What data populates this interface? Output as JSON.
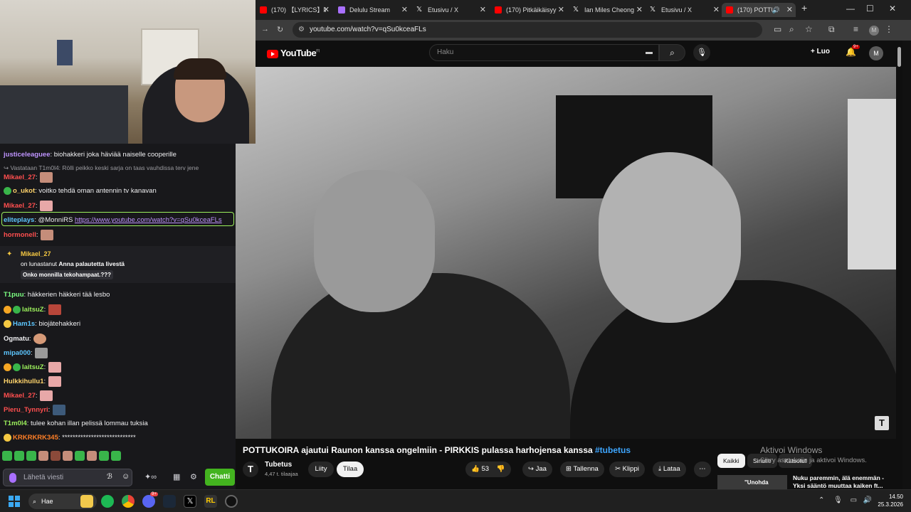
{
  "chat": {
    "messages": [
      {
        "user": "justiceleaguee",
        "color": "#bf94ff",
        "text": "biohakkeri joka häviää naiselle cooperille"
      },
      {
        "reply": "Vastataan T1m0l4: Rölli peikko keski sarja on taas vauhdissa terv jene"
      },
      {
        "user": "Mikael_27",
        "color": "#ff4f4f",
        "text": ""
      },
      {
        "user": "o_ukot",
        "color": "#ffd36b",
        "text": "voitko tehdä oman antennin tv kanavan"
      },
      {
        "user": "Mikael_27",
        "color": "#ff4f4f",
        "text": ""
      },
      {
        "user": "eliteplays",
        "color": "#5dc6ff",
        "text": "@MonniRS ",
        "link": "https://www.youtube.com/watch?v=qSu0kceaFLs"
      },
      {
        "user": "hormonell",
        "color": "#ff4f4f",
        "text": ""
      },
      {
        "user": "T1puu",
        "color": "#7dff83",
        "text": "häkkerien häkkeri tää lesbo"
      },
      {
        "user": "laitsuZ",
        "color": "#9cf05c",
        "text": ""
      },
      {
        "user": "Ham1s",
        "color": "#5dc6ff",
        "text": "biojätehakkeri"
      },
      {
        "user": "Ogmatu",
        "color": "#efeff1",
        "text": ""
      },
      {
        "user": "mipa000",
        "color": "#5dc6ff",
        "text": ""
      },
      {
        "user": "laitsuZ",
        "color": "#9cf05c",
        "text": ""
      },
      {
        "user": "Hulkkihullu1",
        "color": "#ffd36b",
        "text": ""
      },
      {
        "user": "Mikael_27",
        "color": "#ff4f4f",
        "text": ""
      },
      {
        "user": "Pieru_Tynnyri",
        "color": "#ff4f4f",
        "text": ""
      },
      {
        "user": "T1m0l4",
        "color": "#9cf05c",
        "text": "tulee kohan illan pelissä lommau tuksia"
      },
      {
        "user": "KRKRKRK345",
        "color": "#ff7f27",
        "text": "****************************"
      }
    ],
    "redeem": {
      "user": "Mikael_27",
      "line": "on lunastanut",
      "reward": "Anna palautetta livestä",
      "message": "Onko monnilla tekohampaat.???"
    },
    "input_placeholder": "Lähetä viesti",
    "chat_button": "Chatti"
  },
  "browser": {
    "tabs": [
      {
        "title": "(170) 【LYRICS】li",
        "color": "#ff0000"
      },
      {
        "title": "Delulu Stream",
        "color": "#a970ff"
      },
      {
        "title": "Etusivu / X",
        "color": "#ffffff"
      },
      {
        "title": "(170) Pitkäikäisyy",
        "color": "#ff0000"
      },
      {
        "title": "Ian Miles Cheong",
        "color": "#ffffff"
      },
      {
        "title": "Etusivu / X",
        "color": "#ffffff"
      },
      {
        "title": "(170) POTTU",
        "color": "#ff0000"
      }
    ],
    "url": "youtube.com/watch?v=qSu0kceaFLs",
    "profile_initial": "M"
  },
  "youtube": {
    "logo": "YouTube",
    "region": "FI",
    "search_placeholder": "Haku",
    "create_label": "Luo",
    "notif_count": "9+",
    "avatar_initial": "M",
    "video_title": "POTTUKOIRA ajautui Raunon kanssa ongelmiin - PIRKKIS pulassa harhojensa kanssa ",
    "video_hashtag": "#tubetus",
    "channel_name": "Tubetus",
    "channel_subs": "4,47 t. tilaajaa",
    "join_label": "Liity",
    "subscribe_label": "Tilaa",
    "likes": "53",
    "share_label": "Jaa",
    "save_label": "Tallenna",
    "clip_label": "Klippi",
    "download_label": "Lataa",
    "filters": [
      "Kaikki",
      "Sinulle",
      "Katsotut"
    ],
    "rec_title_line1": "Nuku paremmin, älä enemmän -",
    "rec_title_line2": "Yksi sääntö muuttaa kaiken ft...",
    "rec_thumb_text": "\"Unohda",
    "watermark": "T"
  },
  "overlay": {
    "activate_title": "Aktivoi Windows",
    "activate_sub": "Siirry asetuksiin ja aktivoi Windows."
  },
  "taskbar": {
    "search_label": "Hae",
    "time": "14.50",
    "date": "25.3.2026",
    "discord_badge": "9+"
  }
}
